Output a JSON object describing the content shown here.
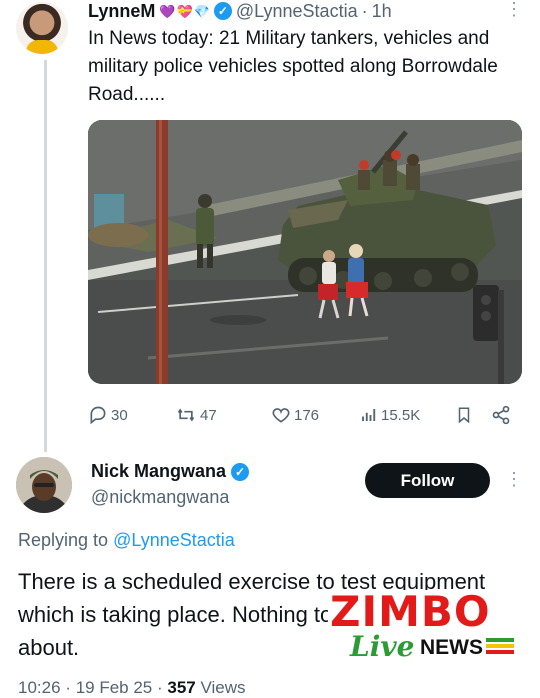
{
  "tweet1": {
    "name": "LynneM",
    "emojis": [
      "💜",
      "💝",
      "💎"
    ],
    "handle": "@LynneStactia",
    "separator": "·",
    "time": "1h",
    "text": "In News today: 21 Military tankers, vehicles and military police vehicles spotted along Borrowdale Road......",
    "more": "⋮",
    "stats": {
      "replies": "30",
      "retweets": "47",
      "likes": "176",
      "views": "15.5K"
    }
  },
  "tweet2": {
    "name": "Nick Mangwana",
    "handle": "@nickmangwana",
    "follow_label": "Follow",
    "more": "⋮",
    "replying_prefix": "Replying to",
    "replying_to": "@LynneStactia",
    "text": "There is a scheduled exercise to test equipment which is taking place. Nothing to be concerned about.",
    "time": "10:26",
    "date": "19 Feb 25",
    "separator": "·",
    "views_count": "357",
    "views_label": "Views"
  },
  "watermark": {
    "title": "ZIMBO",
    "script": "Live",
    "news": "NEWS"
  },
  "colors": {
    "accent": "#1d9bf0",
    "text": "#0f1419",
    "muted": "#536471",
    "watermark_red": "#e21a1a",
    "watermark_green": "#2b9b34"
  }
}
